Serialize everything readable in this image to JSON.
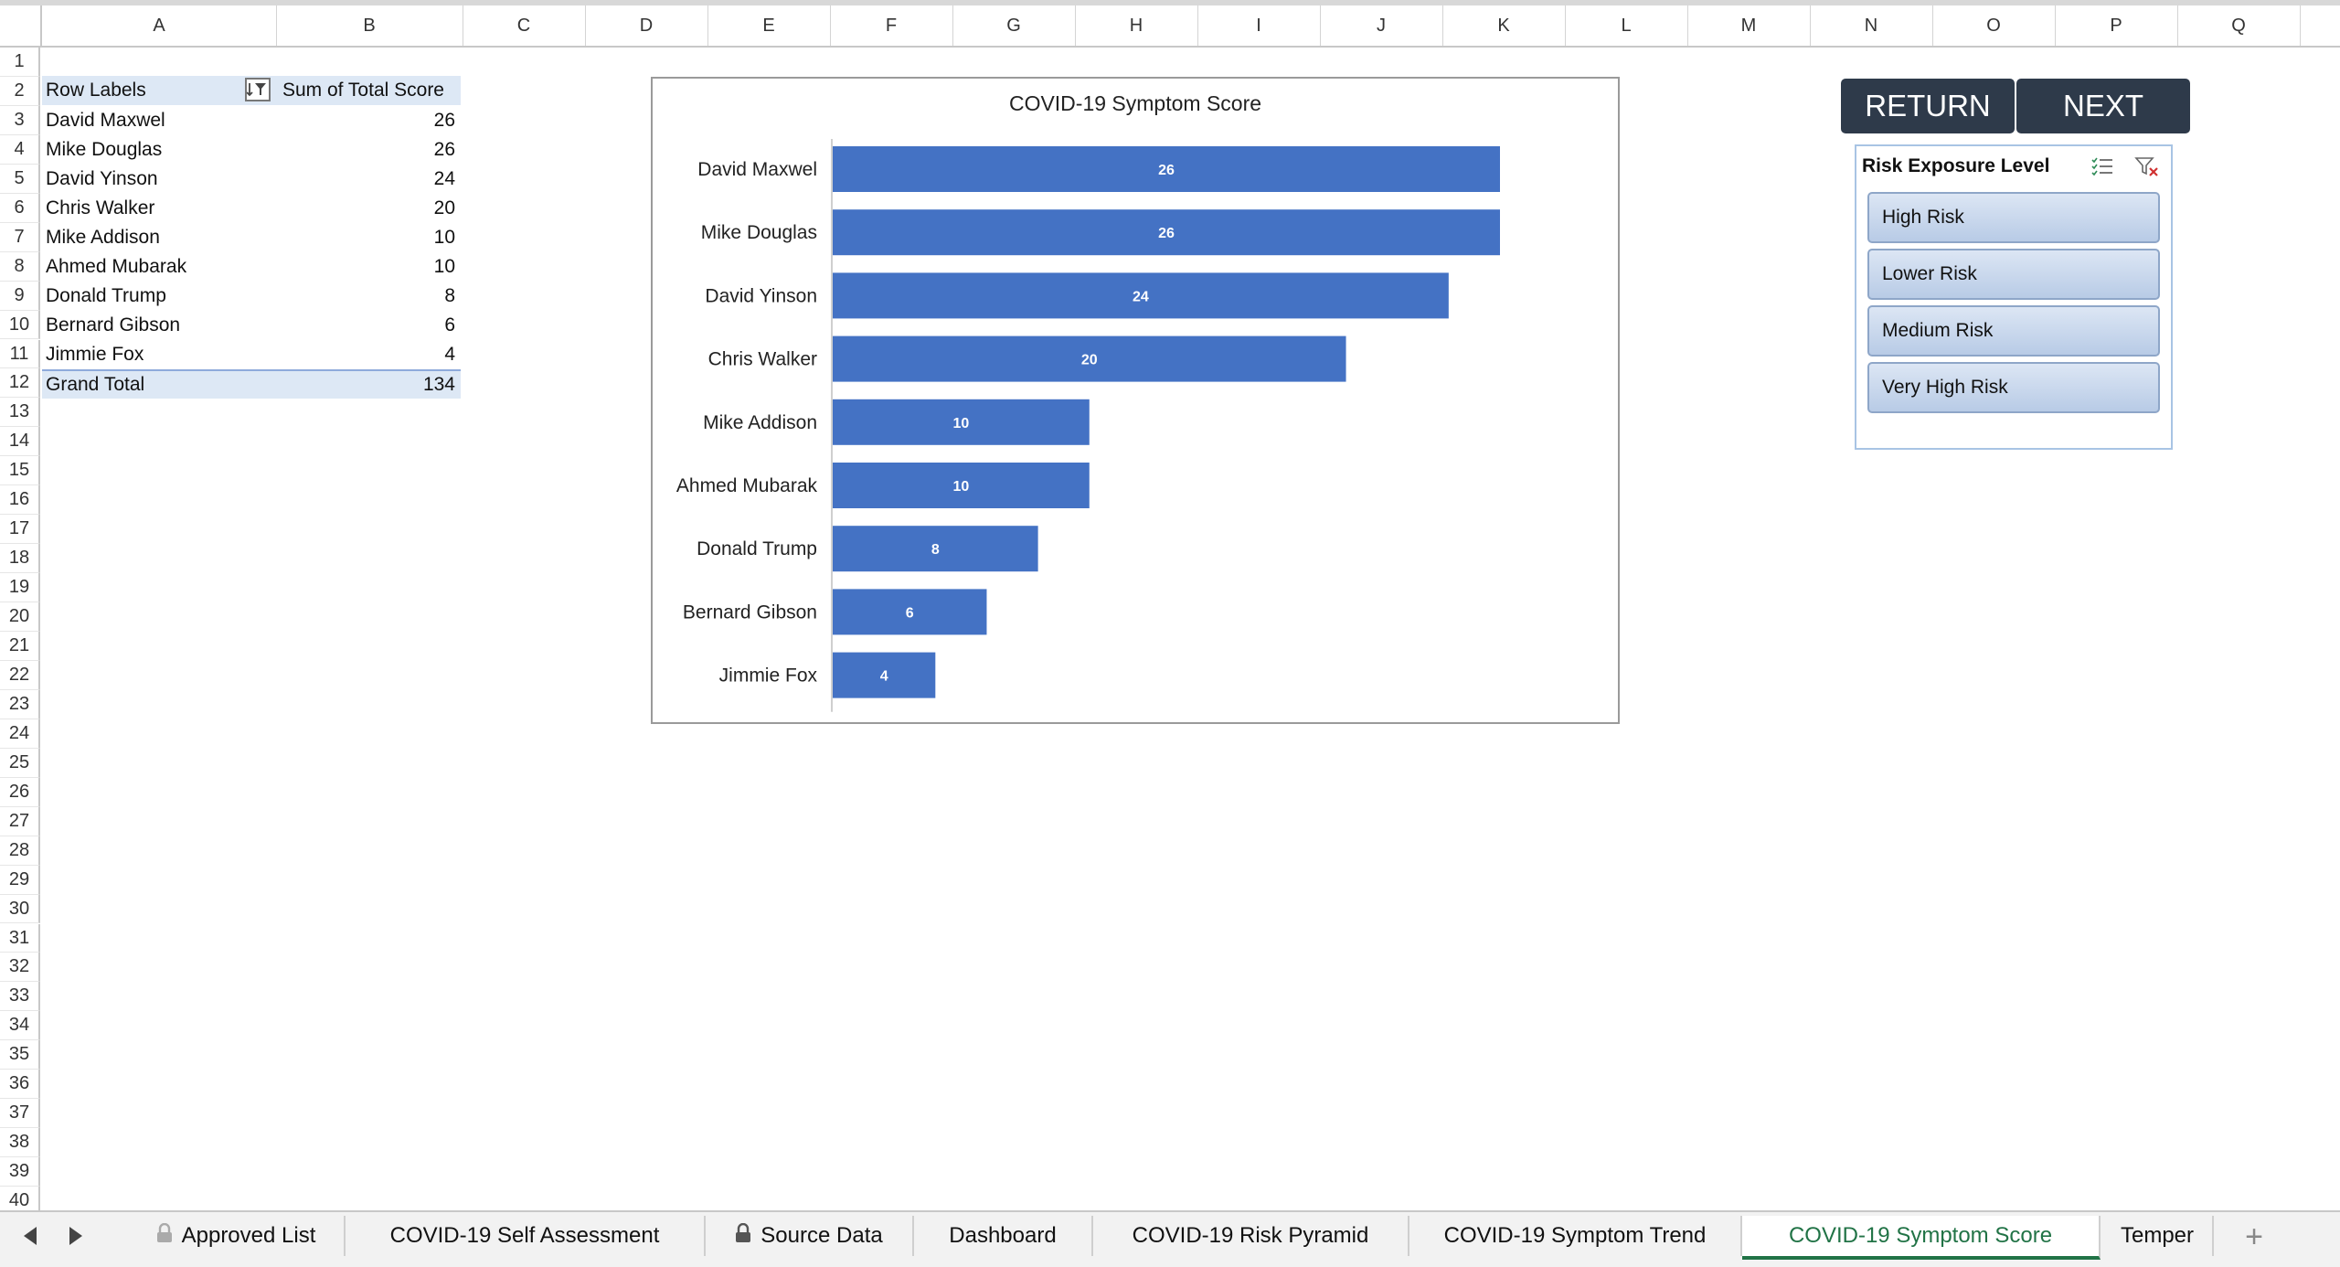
{
  "columns": [
    "A",
    "B",
    "C",
    "D",
    "E",
    "F",
    "G",
    "H",
    "I",
    "J",
    "K",
    "L",
    "M",
    "N",
    "O",
    "P",
    "Q"
  ],
  "rows": [
    "1",
    "2",
    "3",
    "4",
    "5",
    "6",
    "7",
    "8",
    "9",
    "10",
    "11",
    "12",
    "13",
    "14",
    "15",
    "16",
    "17",
    "18",
    "19",
    "20",
    "21",
    "22",
    "23",
    "24",
    "25",
    "26",
    "27",
    "28",
    "29",
    "30",
    "31",
    "32",
    "33",
    "34",
    "35",
    "36",
    "37",
    "38",
    "39",
    "40"
  ],
  "pivot": {
    "header_label": "Row Labels",
    "header_value": "Sum of Total Score",
    "rows": [
      {
        "name": "David Maxwel",
        "value": "26"
      },
      {
        "name": "Mike Douglas",
        "value": "26"
      },
      {
        "name": "David Yinson",
        "value": "24"
      },
      {
        "name": "Chris Walker",
        "value": "20"
      },
      {
        "name": "Mike Addison",
        "value": "10"
      },
      {
        "name": "Ahmed Mubarak",
        "value": "10"
      },
      {
        "name": "Donald Trump",
        "value": "8"
      },
      {
        "name": "Bernard Gibson",
        "value": "6"
      },
      {
        "name": "Jimmie Fox",
        "value": "4"
      }
    ],
    "total_label": "Grand Total",
    "total_value": "134"
  },
  "chart_data": {
    "type": "bar",
    "orientation": "horizontal",
    "title": "COVID-19 Symptom Score",
    "categories": [
      "David Maxwel",
      "Mike Douglas",
      "David Yinson",
      "Chris Walker",
      "Mike Addison",
      "Ahmed Mubarak",
      "Donald Trump",
      "Bernard Gibson",
      "Jimmie Fox"
    ],
    "values": [
      26,
      26,
      24,
      20,
      10,
      10,
      8,
      6,
      4
    ],
    "xlim": [
      0,
      28
    ],
    "bar_color": "#4472c4",
    "data_labels": true,
    "grid": false
  },
  "buttons": {
    "return_label": "RETURN",
    "next_label": "NEXT"
  },
  "slicer": {
    "title": "Risk Exposure Level",
    "items": [
      "High Risk",
      "Lower Risk",
      "Medium Risk",
      "Very High Risk"
    ]
  },
  "tabs": [
    {
      "label": "Approved List",
      "locked": true
    },
    {
      "label": "COVID-19 Self Assessment",
      "locked": false
    },
    {
      "label": "Source Data",
      "locked": true
    },
    {
      "label": "Dashboard",
      "locked": false
    },
    {
      "label": "COVID-19 Risk Pyramid",
      "locked": false
    },
    {
      "label": "COVID-19 Symptom Trend",
      "locked": false
    },
    {
      "label": "COVID-19 Symptom Score",
      "locked": false,
      "active": true
    },
    {
      "label": "Temper",
      "locked": false
    }
  ],
  "icons": {
    "tab_prev": "triangle-left-icon",
    "tab_next": "triangle-right-icon",
    "add_sheet": "plus-icon",
    "lock": "lock-icon",
    "multiselect": "multi-select-icon",
    "clear_filter": "clear-filter-icon",
    "pivot_filter": "filter-dropdown-icon"
  },
  "colors": {
    "accent_green": "#217346",
    "button_dark": "#2e3a4a",
    "bar_blue": "#4472c4",
    "pivot_band": "#dde8f5"
  }
}
